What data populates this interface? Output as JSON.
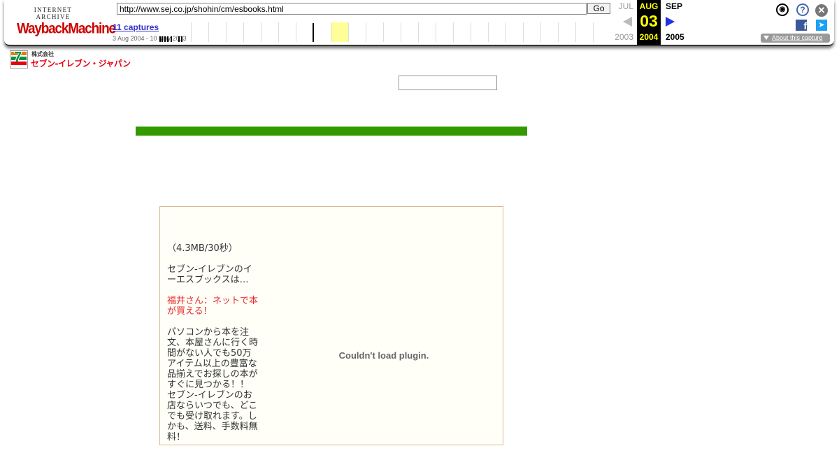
{
  "wayback": {
    "logo_top": "INTERNET ARCHIVE",
    "logo_main": "WaybackMachine",
    "url": "http://www.sej.co.jp/shohin/cm/esbooks.html",
    "go_label": "Go",
    "captures": "11 captures",
    "date_range": "3 Aug 2004 - 10 May 2013",
    "prev": {
      "month": "JUL",
      "year": "2003"
    },
    "current": {
      "month": "AUG",
      "day": "03",
      "year": "2004"
    },
    "next": {
      "month": "SEP",
      "year": "2005"
    },
    "about": "About this capture",
    "icons": [
      "user-icon",
      "help-icon",
      "close-icon",
      "facebook-icon",
      "twitter-icon"
    ]
  },
  "site": {
    "logo_small": "株式会社",
    "logo_name": "セブン-イレブン・ジャパン",
    "search_value": "",
    "accent_green": "#339900"
  },
  "content": {
    "size_note": "（4.3MB/30秒）",
    "intro": "セブン-イレブンのイーエスブックスは…",
    "highlight": "福井さん：ネットで本が買える！",
    "body1": "パソコンから本を注文、本屋さんに行く時間がない人でも50万アイテム以上の豊富な品揃えでお探しの本がすぐに見つかる！！",
    "body2": "セブン-イレブンのお店ならいつでも、どこでも受け取れます。しかも、送料、手数料無料！",
    "plugin_message": "Couldn't load plugin."
  }
}
